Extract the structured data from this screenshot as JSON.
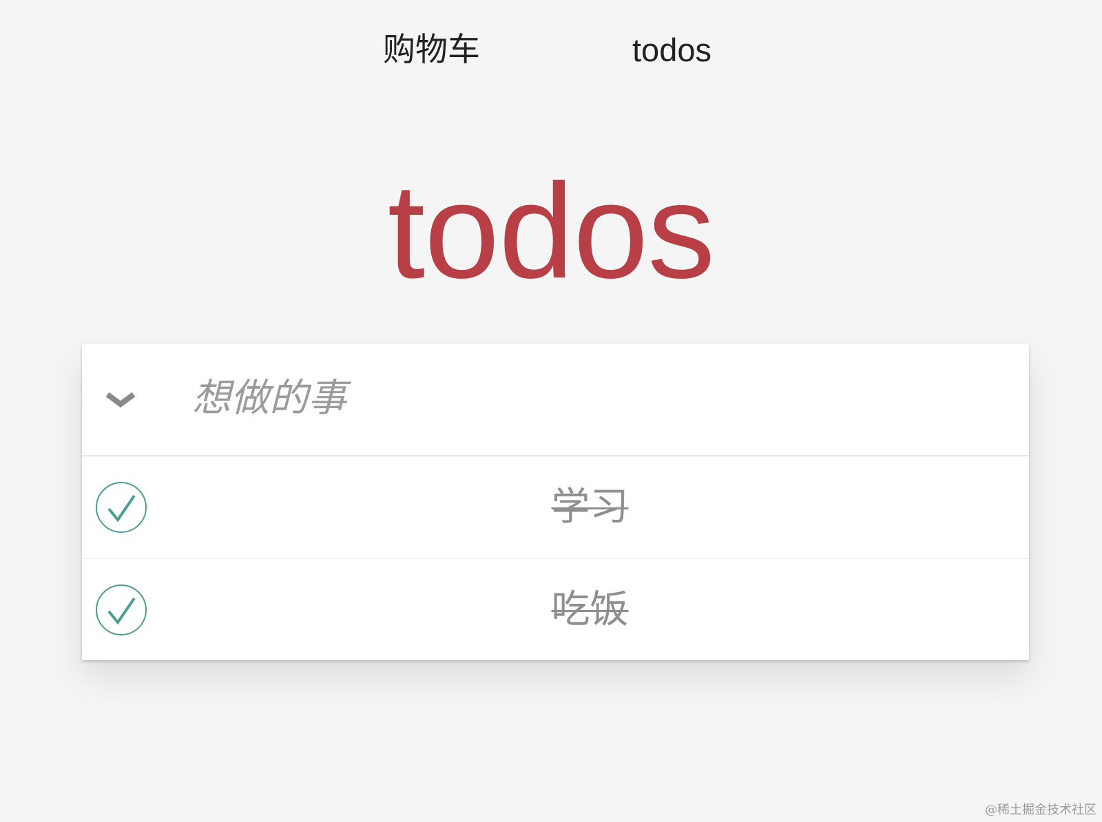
{
  "nav": {
    "links": [
      {
        "label": "购物车"
      },
      {
        "label": "todos"
      }
    ]
  },
  "app": {
    "title": "todos",
    "title_color": "#b83f45",
    "check_color": "#4d9e90",
    "new_todo_placeholder": "想做的事",
    "toggle_all_icon": "chevron-down-icon",
    "todos": [
      {
        "label": "学习",
        "completed": true
      },
      {
        "label": "吃饭",
        "completed": true
      }
    ]
  },
  "watermark": "@稀土掘金技术社区"
}
